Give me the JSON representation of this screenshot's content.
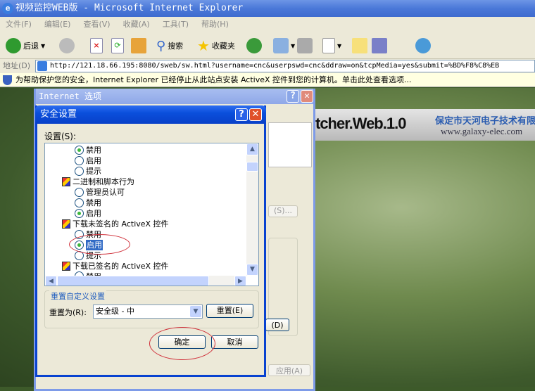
{
  "window": {
    "title": "视频监控WEB版 - Microsoft Internet Explorer"
  },
  "menu": [
    "文件(F)",
    "编辑(E)",
    "查看(V)",
    "收藏(A)",
    "工具(T)",
    "帮助(H)"
  ],
  "toolbar": {
    "back": "后退",
    "search": "搜索",
    "favorites": "收藏夹"
  },
  "address": {
    "label": "地址(D)",
    "url": "http://121.18.66.195:8080/sweb/sw.html?username=cnc&userpswd=cnc&ddraw=on&tcpMedia=yes&submit=%BD%F8%C8%EB"
  },
  "infobar": {
    "text": "为帮助保护您的安全，Internet Explorer 已经停止从此站点安装 ActiveX 控件到您的计算机。单击此处查看选项..."
  },
  "banner": {
    "product": "tcher.Web.1.0",
    "company": "保定市天河电子技术有限公",
    "url": "www.galaxy-elec.com"
  },
  "internet_options": {
    "title": "Internet 选项",
    "custom_button": "(S)...",
    "default_button": "(D)",
    "apply": "应用(A)"
  },
  "security_settings": {
    "title": "安全设置",
    "settings_label": "设置(S):",
    "items": [
      {
        "type": "radio",
        "label": "禁用",
        "checked": true
      },
      {
        "type": "radio",
        "label": "启用",
        "checked": false
      },
      {
        "type": "radio",
        "label": "提示",
        "checked": false
      },
      {
        "type": "category",
        "label": "二进制和脚本行为"
      },
      {
        "type": "radio",
        "label": "管理员认可",
        "checked": false
      },
      {
        "type": "radio",
        "label": "禁用",
        "checked": false
      },
      {
        "type": "radio",
        "label": "启用",
        "checked": true
      },
      {
        "type": "category",
        "label": "下载未签名的 ActiveX 控件"
      },
      {
        "type": "radio",
        "label": "禁用",
        "checked": false
      },
      {
        "type": "radio",
        "label": "启用",
        "checked": true,
        "selected": true
      },
      {
        "type": "radio",
        "label": "提示",
        "checked": false
      },
      {
        "type": "category",
        "label": "下载已签名的 ActiveX 控件"
      },
      {
        "type": "radio",
        "label": "禁用",
        "checked": false
      }
    ],
    "reset_group": "重置自定义设置",
    "reset_to_label": "重置为(R):",
    "reset_level": "安全级 - 中",
    "reset_button": "重置(E)",
    "ok": "确定",
    "cancel": "取消"
  }
}
